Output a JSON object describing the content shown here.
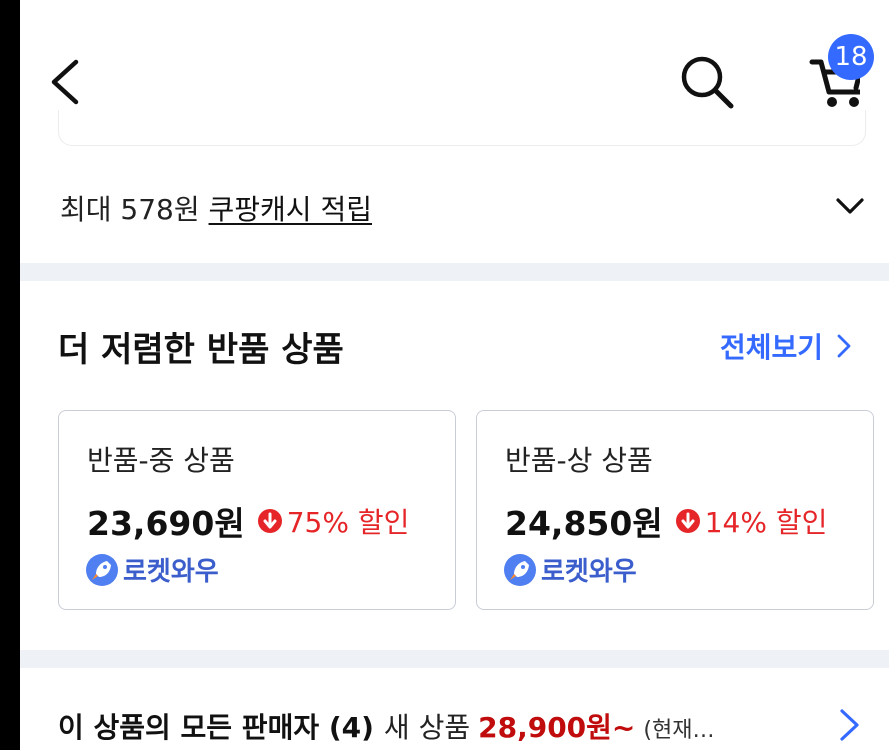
{
  "header": {
    "cart_count": "18",
    "icons": [
      "back-arrow-icon",
      "search-icon",
      "cart-icon"
    ],
    "accent_color": "#346aff"
  },
  "cash": {
    "prefix": "최대 578원",
    "link": "쿠팡캐시 적립"
  },
  "section": {
    "title": "더 저렴한 반품 상품",
    "see_all": "전체보기"
  },
  "products": [
    {
      "grade": "반품-중 상품",
      "price": "23,690원",
      "discount": "75% 할인",
      "badge": "로켓와우"
    },
    {
      "grade": "반품-상 상품",
      "price": "24,850원",
      "discount": "14% 할인",
      "badge": "로켓와우"
    }
  ],
  "sellers": {
    "label": "이 상품의 모든 판매자 (4)",
    "new_label": "새 상품",
    "price": "28,900원~",
    "current": "(현재…"
  },
  "colors": {
    "discount": "#e52528",
    "rocket": "#3b5ecc",
    "price_highlight": "#c00c0c",
    "divider": "#eef1f5"
  }
}
